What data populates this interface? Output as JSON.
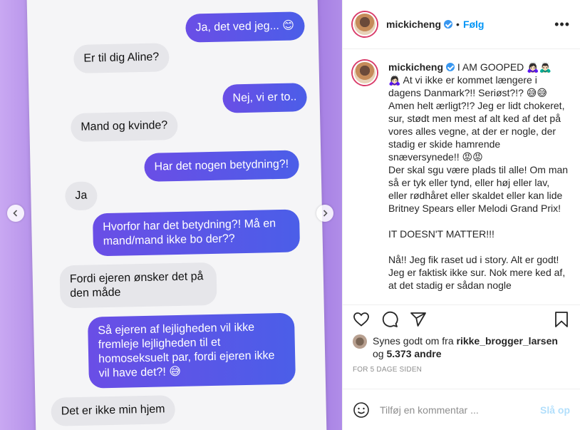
{
  "media": {
    "messages": [
      {
        "side": "out",
        "text": "Ja, det ved jeg... 😊"
      },
      {
        "side": "in",
        "text": "Er til dig Aline?"
      },
      {
        "side": "out",
        "text": "Nej, vi er to.."
      },
      {
        "side": "in",
        "text": "Mand og kvinde?"
      },
      {
        "side": "out",
        "text": "Har det nogen betydning?!"
      },
      {
        "side": "in",
        "text": "Ja"
      },
      {
        "side": "out",
        "text": "Hvorfor har det betydning?! Må en mand/mand ikke bo der??"
      },
      {
        "side": "in",
        "text": "Fordi ejeren ønsker det på den måde"
      },
      {
        "side": "out",
        "text": "Så ejeren af lejligheden vil ikke fremleje lejligheden til et homoseksuelt par, fordi ejeren ikke vil have det?! 😅"
      },
      {
        "side": "in",
        "text": "Det er ikke min hjem"
      }
    ]
  },
  "header": {
    "username": "mickicheng",
    "follow_label": "Følg",
    "dot": "•",
    "more_label": "•••"
  },
  "caption": {
    "username": "mickicheng",
    "text": "I AM GOOPED 🙇🏻‍♀️🙇🏻‍♂️\n🙇🏻‍♀️ At vi ikke er kommet længere i dagens Danmark?!! Seriøst?!? 😅😅\nAmen helt ærligt?!? Jeg er lidt chokeret, sur, stødt men mest af alt ked af det på vores alles vegne, at der er nogle, der stadig er skide hamrende snæversynede!! 😡😡\nDer skal sgu være plads til alle! Om man så er tyk eller tynd, eller høj eller lav, eller rødhåret eller skaldet eller kan lide Britney Spears eller Melodi Grand Prix!\n\nIT DOESN'T MATTER!!!\n\nNå!! Jeg fik raset ud i story. Alt er godt! Jeg er faktisk ikke sur. Nok mere ked af, at det stadig er sådan nogle"
  },
  "likes": {
    "prefix": "Synes godt om fra ",
    "user": "rikke_brogger_larsen",
    "middle": " og ",
    "count": "5.373 andre"
  },
  "date": "FOR 5 DAGE SIDEN",
  "comment": {
    "placeholder": "Tilføj en kommentar ...",
    "post_label": "Slå op"
  },
  "icons": [
    "heart-icon",
    "comment-icon",
    "share-icon",
    "bookmark-icon",
    "emoji-icon",
    "chevron-left-icon",
    "chevron-right-icon",
    "verified-icon"
  ]
}
